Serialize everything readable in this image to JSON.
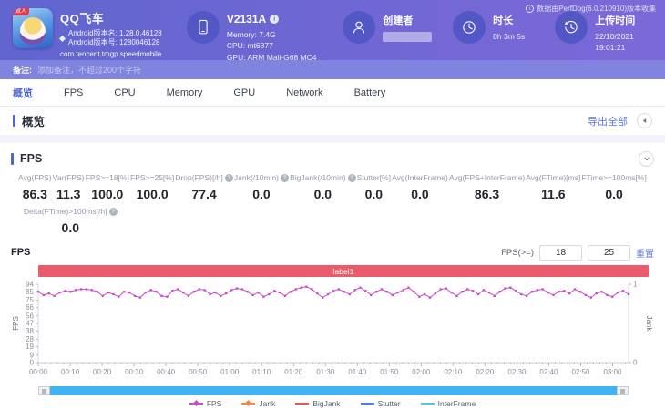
{
  "header": {
    "app": {
      "name": "QQ飞车",
      "icon_badge": "双人",
      "version_name": "Android版本名: 1.28.0.46128",
      "version_code": "Android版本号: 1280046128",
      "package": "com.tencent.tmgp.speedmobile"
    },
    "device": {
      "model": "V2131A",
      "memory": "Memory: 7.4G",
      "cpu": "CPU: mt6877",
      "gpu": "GPU: ARM Mali-G68 MC4"
    },
    "creator": {
      "label": "创建者",
      "name_masked": true
    },
    "duration": {
      "label": "时长",
      "value": "0h 3m 5s"
    },
    "upload": {
      "label": "上传时间",
      "value": "22/10/2021 19:01:21"
    },
    "collector_note": "数据由PerfDog(6.0.210910)版本收集"
  },
  "note_bar": {
    "label": "备注:",
    "placeholder": "添加备注，不超过200个字符"
  },
  "tabs": [
    {
      "key": "overview",
      "label": "概览",
      "active": true
    },
    {
      "key": "fps",
      "label": "FPS",
      "active": false
    },
    {
      "key": "cpu",
      "label": "CPU",
      "active": false
    },
    {
      "key": "memory",
      "label": "Memory",
      "active": false
    },
    {
      "key": "gpu",
      "label": "GPU",
      "active": false
    },
    {
      "key": "network",
      "label": "Network",
      "active": false
    },
    {
      "key": "battery",
      "label": "Battery",
      "active": false
    }
  ],
  "overview": {
    "title": "概览",
    "export_label": "导出全部"
  },
  "fps_section": {
    "title": "FPS",
    "metrics_row1": [
      {
        "label": "Avg(FPS)",
        "value": "86.3",
        "info": false
      },
      {
        "label": "Var(FPS)",
        "value": "11.3",
        "info": false
      },
      {
        "label": "FPS>=18[%]",
        "value": "100.0",
        "info": false
      },
      {
        "label": "FPS>=25[%]",
        "value": "100.0",
        "info": false
      },
      {
        "label": "Drop(FPS)[/h]",
        "value": "77.4",
        "info": true
      },
      {
        "label": "Jank(/10min)",
        "value": "0.0",
        "info": true
      },
      {
        "label": "BigJank(/10min)",
        "value": "0.0",
        "info": true
      },
      {
        "label": "Stutter[%]",
        "value": "0.0",
        "info": false
      },
      {
        "label": "Avg(InterFrame)",
        "value": "0.0",
        "info": false
      },
      {
        "label": "Avg(FPS+InterFrame)",
        "value": "86.3",
        "info": false
      },
      {
        "label": "Avg(FTime)[ms]",
        "value": "11.6",
        "info": false
      },
      {
        "label": "FTime>=100ms[%]",
        "value": "0.0",
        "info": false
      }
    ],
    "metrics_row2": [
      {
        "label": "Delta(FTime)>100ms[/h]",
        "value": "0.0",
        "info": true
      }
    ],
    "chart_controls": {
      "label": "FPS(>=)",
      "input1": "18",
      "input2": "25",
      "reset_label": "重置"
    },
    "chart_title": "FPS",
    "annotation_label": "label1"
  },
  "chart_data": {
    "type": "line",
    "title": "FPS",
    "annotation": "label1",
    "duration_seconds": 185,
    "x_ticks": [
      "00:00",
      "00:10",
      "00:20",
      "00:30",
      "00:40",
      "00:50",
      "01:00",
      "01:10",
      "01:20",
      "01:30",
      "01:40",
      "01:50",
      "02:00",
      "02:10",
      "02:20",
      "02:30",
      "02:40",
      "02:50",
      "03:00"
    ],
    "y_left": {
      "label": "FPS",
      "ticks": [
        0,
        9,
        19,
        28,
        38,
        47,
        56,
        66,
        75,
        85,
        94
      ],
      "max": 94
    },
    "y_right": {
      "label": "Jank",
      "ticks": [
        0,
        1
      ],
      "max": 1
    },
    "grid": false,
    "legend_position": "bottom",
    "series": [
      {
        "name": "FPS",
        "color": "#c94fc9",
        "marker": "diamond",
        "values": [
          85,
          81,
          83,
          80,
          84,
          86,
          85,
          87,
          88,
          88,
          87,
          85,
          80,
          84,
          82,
          79,
          85,
          84,
          80,
          78,
          84,
          87,
          85,
          80,
          79,
          86,
          88,
          84,
          80,
          85,
          88,
          87,
          82,
          84,
          80,
          83,
          87,
          89,
          88,
          85,
          81,
          84,
          79,
          82,
          86,
          84,
          80,
          85,
          88,
          90,
          91,
          88,
          83,
          78,
          82,
          86,
          88,
          85,
          82,
          87,
          90,
          86,
          81,
          85,
          88,
          85,
          81,
          84,
          87,
          90,
          85,
          79,
          82,
          78,
          83,
          88,
          89,
          84,
          80,
          85,
          88,
          86,
          82,
          87,
          84,
          80,
          85,
          89,
          90,
          86,
          82,
          80,
          85,
          87,
          88,
          84,
          81,
          85,
          86,
          83,
          88,
          85,
          81,
          78,
          83,
          85,
          81,
          79,
          84,
          86,
          82
        ]
      },
      {
        "name": "Jank",
        "color": "#f2873f",
        "marker": "diamond",
        "values": []
      },
      {
        "name": "BigJank",
        "color": "#e8544f",
        "marker": "line",
        "values": []
      },
      {
        "name": "Stutter",
        "color": "#4d7df2",
        "marker": "line",
        "values": []
      },
      {
        "name": "InterFrame",
        "color": "#49c6e8",
        "marker": "line",
        "values": []
      }
    ]
  }
}
